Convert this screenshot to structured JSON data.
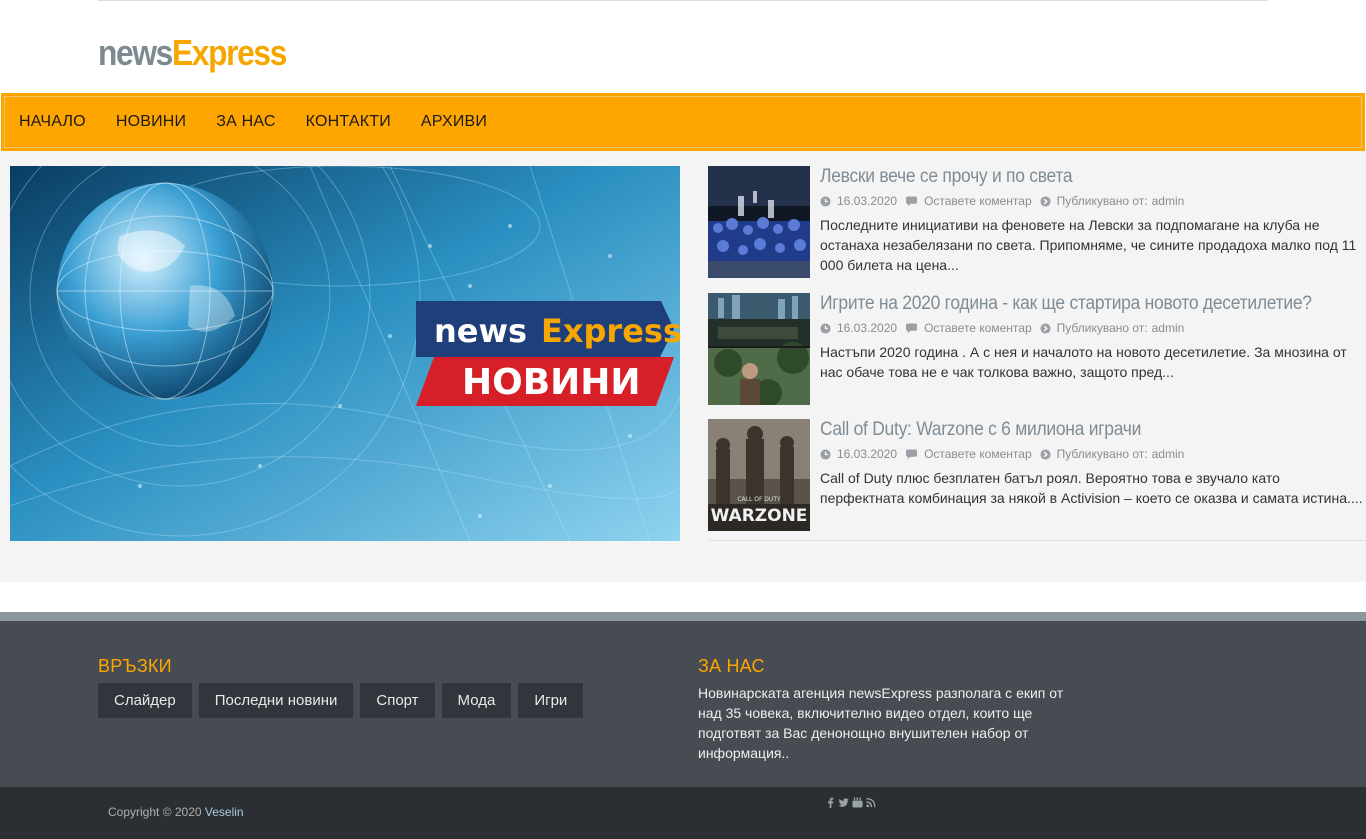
{
  "header": {
    "logo_part1": "news",
    "logo_part2": "Express"
  },
  "nav": {
    "items": [
      "НАЧАЛО",
      "НОВИНИ",
      "ЗА НАС",
      "КОНТАКТИ",
      "АРХИВИ"
    ]
  },
  "hero": {
    "logo_news": "news",
    "logo_express": "Express",
    "banner_text": "НОВИНИ"
  },
  "posts": [
    {
      "title": "Левски вече се прочу и по света",
      "date": "16.03.2020",
      "comments": "Оставете коментар",
      "published_by": "Публикувано от:",
      "author": "admin",
      "excerpt": "Последните инициативи на феновете на Левски за подпомагане на клуба не останаха незабелязани по света. Припомняме, че сините продадоха малко под 11 000 билета на цена..."
    },
    {
      "title": "Игрите на 2020 година - как ще стартира новото десетилетие?",
      "date": "16.03.2020",
      "comments": "Оставете коментар",
      "published_by": "Публикувано от:",
      "author": "admin",
      "excerpt": "Настъпи 2020 година . А с нея и началото на новото десетилетие. За мнозина от нас обаче това не е чак толкова важно, защото пред..."
    },
    {
      "title": "Call of Duty: Warzone с 6 милиона играчи",
      "date": "16.03.2020",
      "comments": "Оставете коментар",
      "published_by": "Публикувано от:",
      "author": "admin",
      "excerpt": "Call of Duty плюс безплатен батъл роял. Вероятно това е звучало като перфектната комбинация за някой в Activision – което се оказва и самата истина...."
    }
  ],
  "thumbs": {
    "warzone_caption": "WARZONE",
    "warzone_small": "CALL OF DUTY"
  },
  "footer": {
    "links_title": "ВРЪЗКИ",
    "links": [
      "Слайдер",
      "Последни новини",
      "Спорт",
      "Мода",
      "Игри"
    ],
    "about_title": "ЗА НАС",
    "about_text": "Новинарската агенция newsExpress разполага с екип от над 35 човека, включително видео отдел, които ще подготвят за Вас денонощно внушителен набор от информация.."
  },
  "bottom": {
    "copyright": "Copyright © 2020",
    "owner": "Veselin"
  },
  "colors": {
    "accent": "#ffa500",
    "footer_bg": "#464c52",
    "bottom_bg": "#2b2f33"
  },
  "icons": {
    "meta": [
      "clock-icon",
      "comment-icon",
      "user-icon"
    ],
    "social": [
      "facebook-icon",
      "twitter-icon",
      "youtube-icon",
      "rss-icon"
    ]
  }
}
